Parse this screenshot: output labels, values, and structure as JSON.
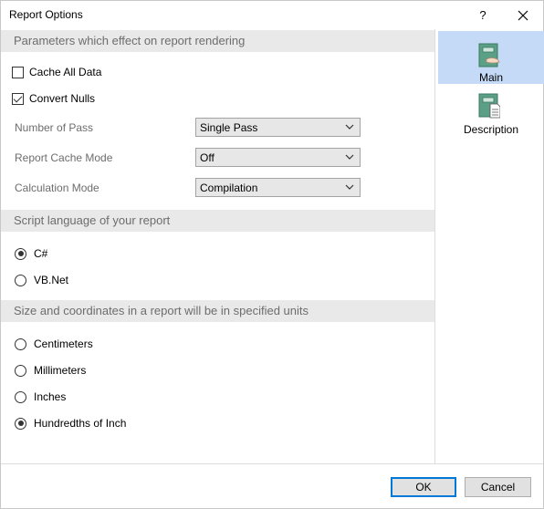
{
  "window": {
    "title": "Report Options",
    "help_glyph": "?",
    "close_glyph": "✕"
  },
  "sections": {
    "rendering": {
      "header": "Parameters which effect on report rendering",
      "cache_all_data": {
        "label": "Cache All Data",
        "checked": false
      },
      "convert_nulls": {
        "label": "Convert Nulls",
        "checked": true
      },
      "fields": {
        "number_of_pass": {
          "label": "Number of Pass",
          "value": "Single Pass"
        },
        "report_cache_mode": {
          "label": "Report Cache Mode",
          "value": "Off"
        },
        "calculation_mode": {
          "label": "Calculation Mode",
          "value": "Compilation"
        }
      }
    },
    "script_language": {
      "header": "Script language of your report",
      "options": [
        {
          "label": "C#",
          "checked": true
        },
        {
          "label": "VB.Net",
          "checked": false
        }
      ]
    },
    "units": {
      "header": "Size and coordinates in a report will be in specified units",
      "options": [
        {
          "label": "Centimeters",
          "checked": false
        },
        {
          "label": "Millimeters",
          "checked": false
        },
        {
          "label": "Inches",
          "checked": false
        },
        {
          "label": "Hundredths of Inch",
          "checked": true
        }
      ]
    }
  },
  "nav": {
    "items": [
      {
        "label": "Main",
        "icon": "main-page-icon",
        "selected": true
      },
      {
        "label": "Description",
        "icon": "description-page-icon",
        "selected": false
      }
    ]
  },
  "footer": {
    "ok_label": "OK",
    "cancel_label": "Cancel"
  },
  "colors": {
    "section_header_bg": "#e9e9e9",
    "selected_nav_bg": "#c4daf7",
    "default_button_border": "#0078d7"
  }
}
